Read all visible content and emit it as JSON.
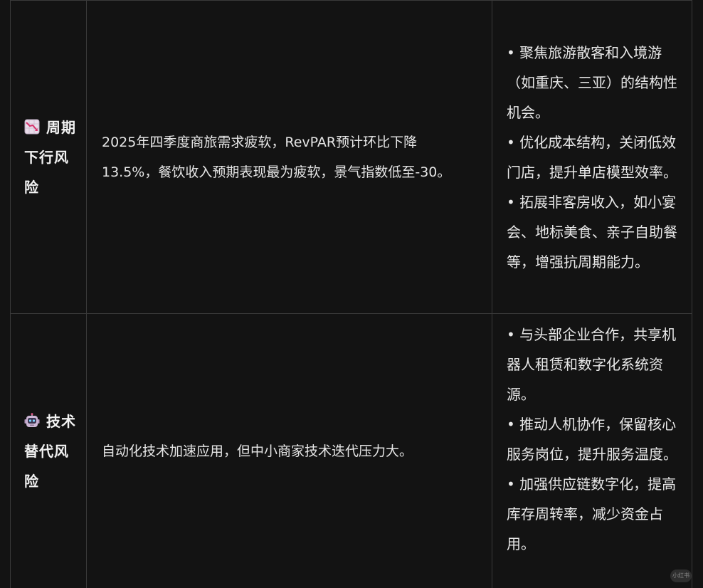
{
  "rows": [
    {
      "icon": "chart-decreasing-icon",
      "name": "周期下行风险",
      "description": "2025年四季度商旅需求疲软，RevPAR预计环比下降13.5%，餐饮收入预期表现最为疲软，景气指数低至-30。",
      "actions": [
        "• 聚焦旅游散客和入境游（如重庆、三亚）的结构性机会。",
        "• 优化成本结构，关闭低效门店，提升单店模型效率。",
        "• 拓展非客房收入，如小宴会、地标美食、亲子自助餐等，增强抗周期能力。"
      ]
    },
    {
      "icon": "robot-icon",
      "name": "技术替代风险",
      "description": "自动化技术加速应用，但中小商家技术迭代压力大。",
      "actions": [
        "• 与头部企业合作，共享机器人租赁和数字化系统资源。",
        "• 推动人机协作，保留核心服务岗位，提升服务温度。",
        "• 加强供应链数字化，提高库存周转率，减少资金占用。"
      ]
    }
  ],
  "watermark": "小红书"
}
